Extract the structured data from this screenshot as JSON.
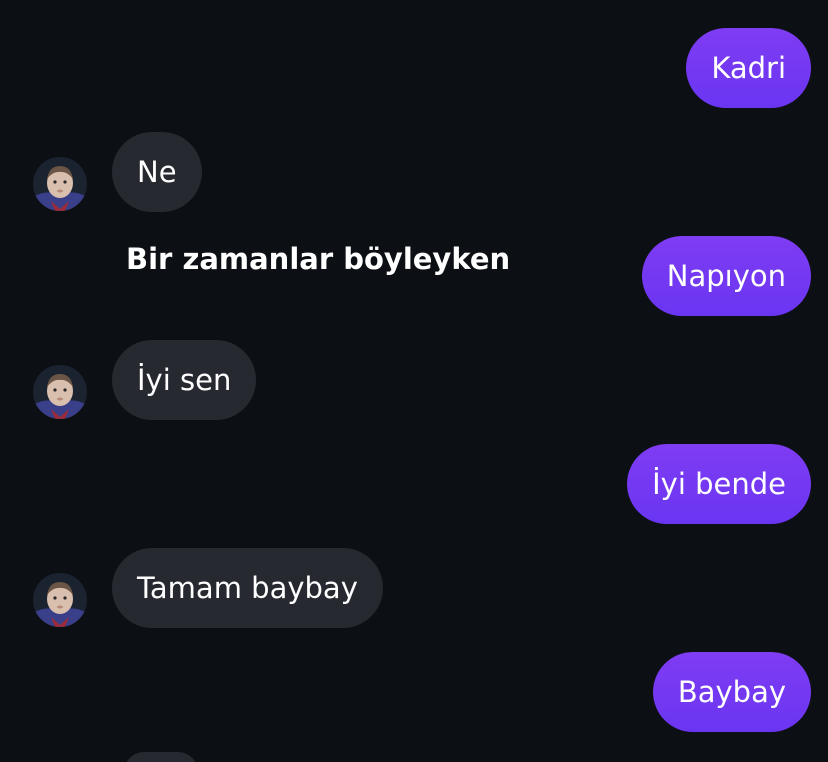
{
  "messages": [
    {
      "side": "sent",
      "text": "Kadri"
    },
    {
      "side": "received",
      "text": "Ne"
    },
    {
      "side": "sent",
      "text": "Napıyon"
    },
    {
      "side": "received",
      "text": "İyi sen"
    },
    {
      "side": "sent",
      "text": "İyi bende"
    },
    {
      "side": "received",
      "text": "Tamam baybay"
    },
    {
      "side": "sent",
      "text": "Baybay"
    }
  ],
  "caption": "Bir zamanlar böyleyken",
  "colors": {
    "background": "#0c1014",
    "sent_bubble": "#7339f3",
    "received_bubble": "#262a30",
    "text": "#ffffff"
  },
  "icons": {
    "avatar": "child-photo-avatar"
  }
}
